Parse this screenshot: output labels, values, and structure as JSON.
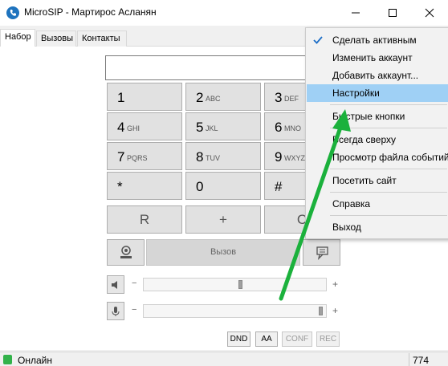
{
  "window": {
    "title": "MicroSIP - Мартирос Асланян",
    "icons": {
      "app": "microsip-logo-icon",
      "min": "minimize-icon",
      "max": "maximize-icon",
      "close": "close-icon"
    }
  },
  "tabs": [
    "Набор",
    "Вызовы",
    "Контакты"
  ],
  "dialer": {
    "number_value": "",
    "keys": [
      {
        "digit": "1",
        "letters": ""
      },
      {
        "digit": "2",
        "letters": "ABC"
      },
      {
        "digit": "3",
        "letters": "DEF"
      },
      {
        "digit": "4",
        "letters": "GHI"
      },
      {
        "digit": "5",
        "letters": "JKL"
      },
      {
        "digit": "6",
        "letters": "MNO"
      },
      {
        "digit": "7",
        "letters": "PQRS"
      },
      {
        "digit": "8",
        "letters": "TUV"
      },
      {
        "digit": "9",
        "letters": "WXYZ"
      },
      {
        "digit": "*",
        "letters": ""
      },
      {
        "digit": "0",
        "letters": ""
      },
      {
        "digit": "#",
        "letters": ""
      },
      {
        "digit": "R",
        "letters": ""
      },
      {
        "digit": "+",
        "letters": ""
      },
      {
        "digit": "C",
        "letters": ""
      }
    ],
    "call_label": "Вызов",
    "icons": {
      "video": "webcam-icon",
      "message": "chat-bubble-icon",
      "speaker": "speaker-icon",
      "mic": "microphone-icon"
    }
  },
  "volume": {
    "minus": "−",
    "plus": "+",
    "speaker_level": 0.53,
    "mic_level": 0.98
  },
  "toggles": [
    {
      "label": "DND",
      "enabled": true
    },
    {
      "label": "AA",
      "enabled": true
    },
    {
      "label": "CONF",
      "enabled": false
    },
    {
      "label": "REC",
      "enabled": false
    }
  ],
  "status": {
    "text": "Онлайн",
    "count": "774",
    "color": "#32b24a"
  },
  "context_menu": {
    "items": [
      {
        "label": "Сделать активным",
        "checked": true
      },
      {
        "label": "Изменить аккаунт"
      },
      {
        "label": "Добавить аккаунт..."
      },
      {
        "label": "Настройки",
        "highlighted": true
      },
      {
        "label": "Быстрые кнопки"
      },
      {
        "label": "Всегда сверху"
      },
      {
        "label": "Просмотр файла событий"
      },
      {
        "label": "Посетить сайт"
      },
      {
        "label": "Справка"
      },
      {
        "label": "Выход"
      }
    ],
    "highlight_color": "#9fd0f5"
  },
  "annotation": {
    "color": "#1bb13c"
  }
}
